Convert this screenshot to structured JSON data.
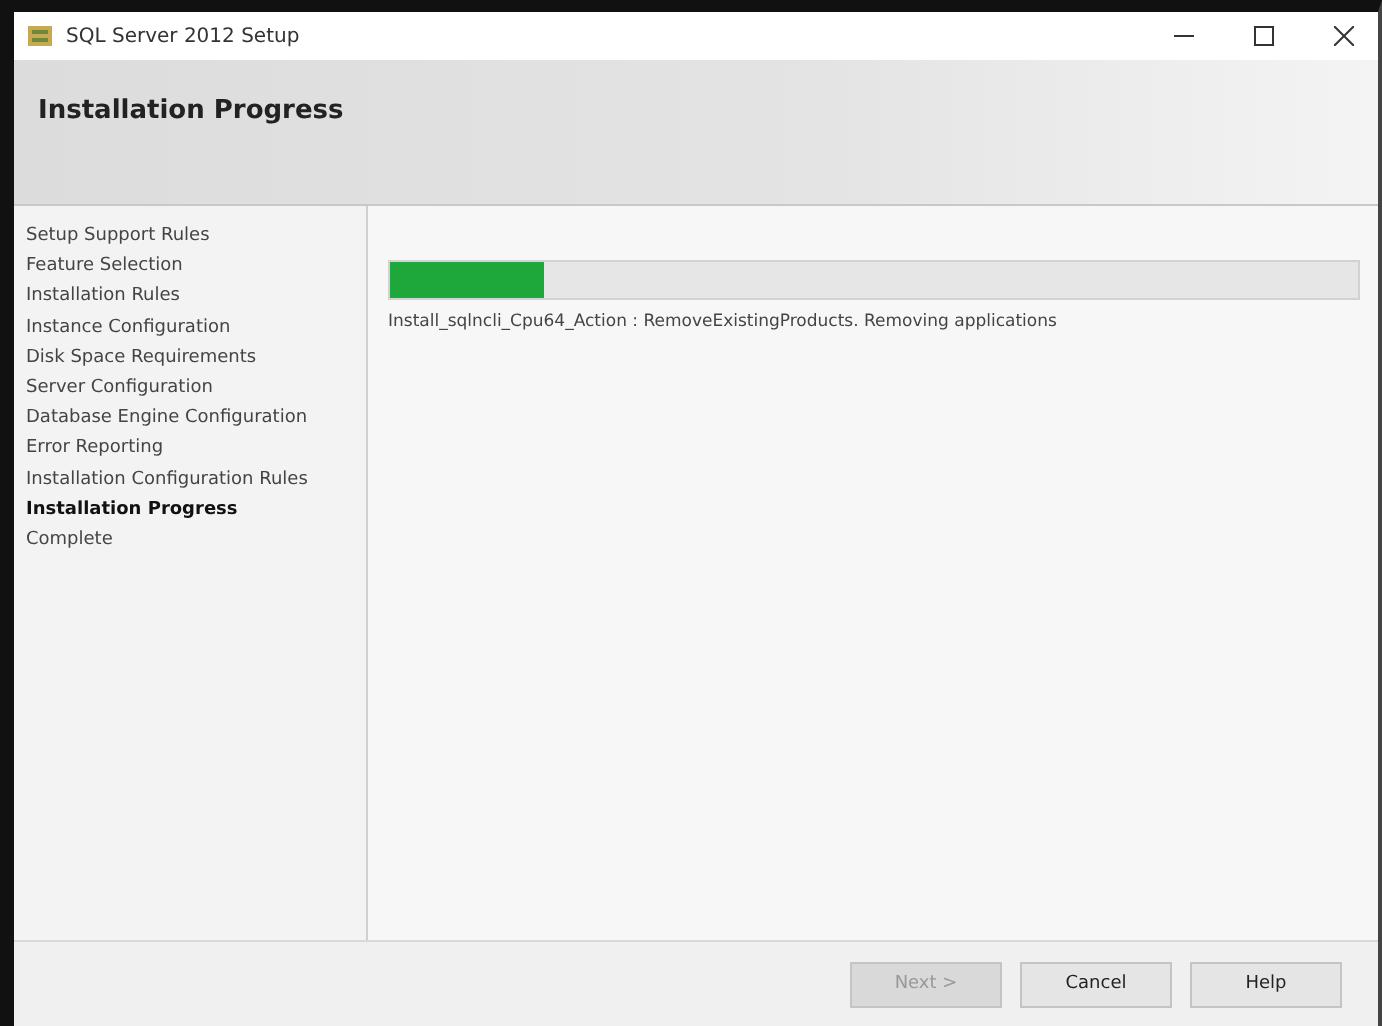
{
  "window": {
    "title": "SQL Server 2012 Setup"
  },
  "header": {
    "title": "Installation Progress"
  },
  "sidebar": {
    "items": [
      {
        "label": "Setup Support Rules",
        "selected": false
      },
      {
        "label": "Feature Selection",
        "selected": false
      },
      {
        "label": "Installation Rules",
        "selected": false
      },
      {
        "label": "Instance Configuration",
        "selected": false
      },
      {
        "label": "Disk Space Requirements",
        "selected": false
      },
      {
        "label": "Server Configuration",
        "selected": false
      },
      {
        "label": "Database Engine Configuration",
        "selected": false
      },
      {
        "label": "Error Reporting",
        "selected": false
      },
      {
        "label": "Installation Configuration Rules",
        "selected": false
      },
      {
        "label": "Installation Progress",
        "selected": true
      },
      {
        "label": "Complete",
        "selected": false
      }
    ]
  },
  "progress": {
    "level": 0.16,
    "status": "Install_sqlncli_Cpu64_Action : RemoveExistingProducts. Removing applications"
  },
  "buttons": [
    {
      "label": "Next >",
      "disabled": true
    },
    {
      "label": "Cancel",
      "disabled": false
    },
    {
      "label": "Help",
      "disabled": false
    }
  ]
}
